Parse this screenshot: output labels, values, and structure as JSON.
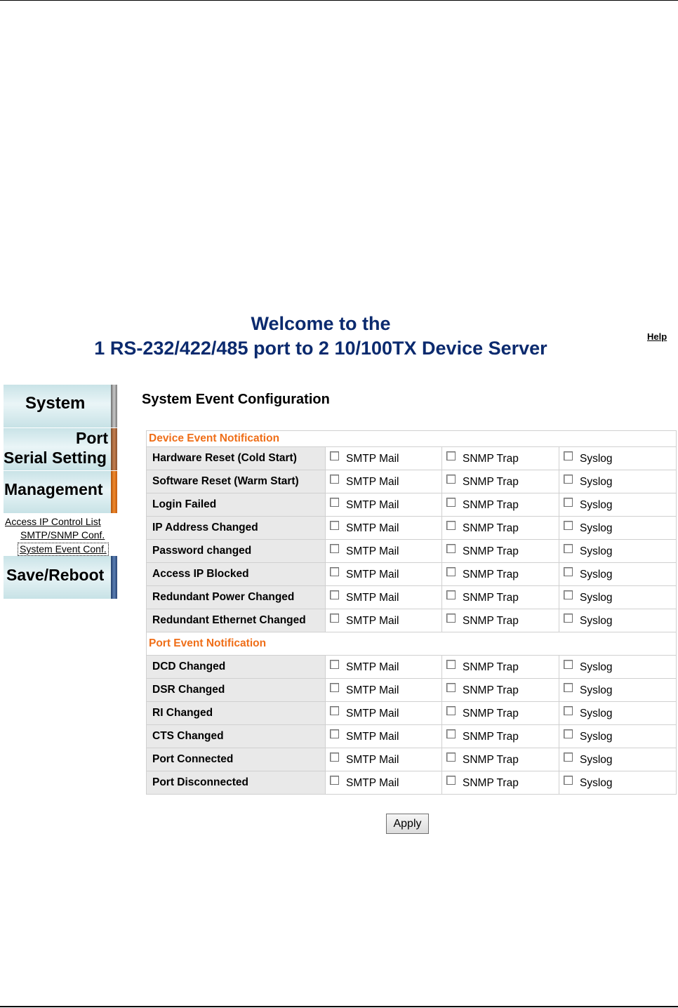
{
  "header": {
    "welcome_line1": "Welcome to the",
    "welcome_line2": "1 RS-232/422/485 port to 2 10/100TX Device Server",
    "help_label": "Help"
  },
  "sidebar": {
    "system_label": "System",
    "port_label_line1": "Port",
    "port_label_line2": "Serial Setting",
    "management_label": "Management",
    "management_links": [
      "Access IP Control List",
      "SMTP/SNMP Conf.",
      "System Event Conf."
    ],
    "save_reboot_label": "Save/Reboot"
  },
  "main": {
    "title": "System Event Configuration",
    "options": [
      "SMTP Mail",
      "SNMP Trap",
      "Syslog"
    ],
    "device_section_title": "Device Event Notification",
    "device_events": [
      "Hardware Reset (Cold Start)",
      "Software Reset (Warm Start)",
      "Login Failed",
      "IP Address Changed",
      "Password changed",
      "Access IP Blocked",
      "Redundant Power Changed",
      "Redundant Ethernet Changed"
    ],
    "port_section_title": "Port Event Notification",
    "port_events": [
      "DCD Changed",
      "DSR Changed",
      "RI Changed",
      "CTS Changed",
      "Port Connected",
      "Port Disconnected"
    ],
    "apply_label": "Apply"
  },
  "colors": {
    "title_blue": "#0b2a6e",
    "section_orange": "#ef6e18",
    "label_bg": "#e9e9e9"
  }
}
